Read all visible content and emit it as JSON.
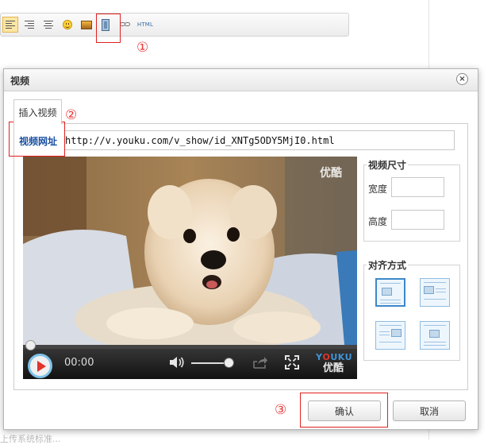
{
  "annotations": {
    "step1": "①",
    "step2": "②",
    "step3": "③"
  },
  "background": {
    "footer_text": "上传系统标准..."
  },
  "toolbar": {
    "html_label": "HTML",
    "icons": [
      "align-left-icon",
      "align-right-icon",
      "align-center-icon",
      "emoticon-icon",
      "image-icon",
      "video-icon",
      "link-icon",
      "html-icon"
    ]
  },
  "dialog": {
    "title": "视频",
    "close_glyph": "×",
    "tab_label": "插入视频",
    "url_label": "视频网址",
    "url_value": "http://v.youku.com/v_show/id_XNTg5ODY5MjI0.html",
    "player": {
      "watermark": "优酷",
      "time": "00:00",
      "logo_en": "YOUKU",
      "logo_cn": "优酷",
      "progress": 0,
      "volume": 0.9
    },
    "size_section": {
      "legend": "视频尺寸",
      "width_label": "宽度",
      "height_label": "高度",
      "width_value": "",
      "height_value": ""
    },
    "align_section": {
      "legend": "对齐方式",
      "options": [
        "none",
        "left",
        "right",
        "center"
      ],
      "selected": "none"
    },
    "confirm_label": "确认",
    "cancel_label": "取消"
  },
  "colors": {
    "accent_blue": "#1a4fa0",
    "annotation_red": "#e02020",
    "youku_blue": "#3f93d8",
    "play_red": "#e0342d"
  }
}
